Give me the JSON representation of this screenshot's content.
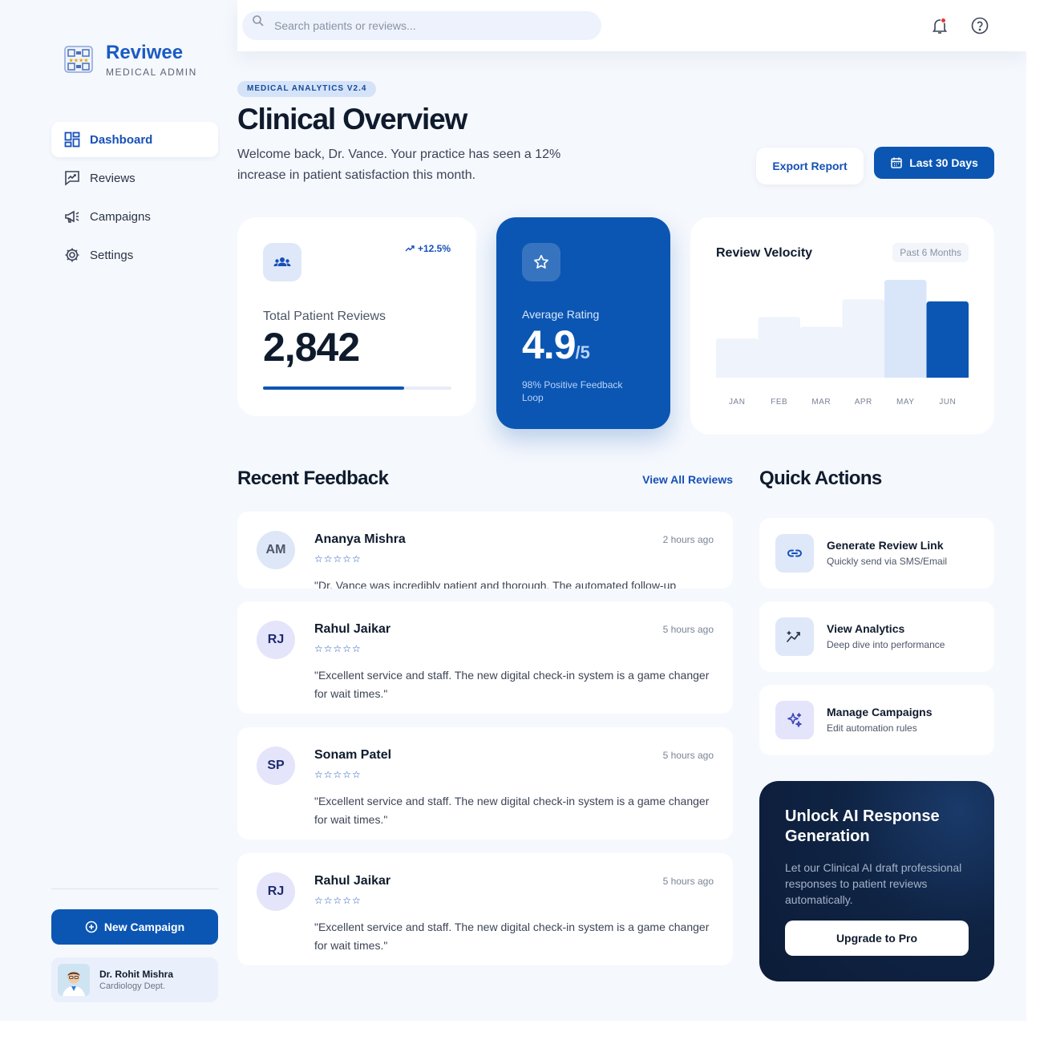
{
  "brand": {
    "name": "Reviwee",
    "subtitle": "MEDICAL ADMIN"
  },
  "nav": [
    {
      "label": "Dashboard",
      "icon": "dashboard-icon",
      "active": true
    },
    {
      "label": "Reviews",
      "icon": "reviews-icon",
      "active": false
    },
    {
      "label": "Campaigns",
      "icon": "megaphone-icon",
      "active": false
    },
    {
      "label": "Settings",
      "icon": "gear-icon",
      "active": false
    }
  ],
  "sidebar": {
    "new_campaign_label": "New Campaign"
  },
  "profile": {
    "name": "Dr. Rohit Mishra",
    "dept": "Cardiology Dept."
  },
  "search": {
    "placeholder": "Search patients or reviews..."
  },
  "header": {
    "badge": "MEDICAL ANALYTICS V2.4",
    "title": "Clinical Overview",
    "subtitle": "Welcome back, Dr. Vance. Your practice has seen a 12% increase in patient satisfaction this month.",
    "export_label": "Export Report",
    "range_label": "Last 30 Days"
  },
  "stats": {
    "total_reviews": {
      "label": "Total Patient Reviews",
      "value": "2,842",
      "trend": "+12.5%",
      "progress": 0.75
    },
    "rating": {
      "label": "Average Rating",
      "value": "4.9",
      "suffix": "/5",
      "footer": "98% Positive Feedback Loop"
    }
  },
  "velocity": {
    "title": "Review Velocity",
    "period": "Past 6 Months"
  },
  "chart_data": {
    "type": "bar",
    "title": "Review Velocity",
    "categories": [
      "JAN",
      "FEB",
      "MAR",
      "APR",
      "MAY",
      "JUN"
    ],
    "values": [
      40,
      62,
      52,
      80,
      100,
      78
    ],
    "ylim": [
      0,
      100
    ],
    "grid": false,
    "highlight": "JUN",
    "colors": {
      "base": "#eef3fc",
      "mid": "#d9e6fa",
      "highlight": "#0b56b3"
    }
  },
  "feedback": {
    "title": "Recent Feedback",
    "view_all": "View All Reviews",
    "items": [
      {
        "initials": "AM",
        "name": "Ananya Mishra",
        "time": "2 hours ago",
        "stars": "☆☆☆☆☆",
        "text": "\"Dr. Vance was incredibly patient and thorough. The automated follow-up reminders were a nice touch of professionalism for my procedure.\"",
        "avatar_bg": "#dde7f7",
        "avatar_fg": "#4d5668"
      },
      {
        "initials": "RJ",
        "name": "Rahul Jaikar",
        "time": "5 hours ago",
        "stars": "☆☆☆☆☆",
        "text": "\"Excellent service and staff. The new digital check-in system is a game changer for wait times.\"",
        "avatar_bg": "#e4e4fb",
        "avatar_fg": "#1d2a6e"
      },
      {
        "initials": "SP",
        "name": "Sonam Patel",
        "time": "5 hours ago",
        "stars": "☆☆☆☆☆",
        "text": "\"Excellent service and staff. The new digital check-in system is a game changer for wait times.\"",
        "avatar_bg": "#e4e4fb",
        "avatar_fg": "#1d2a6e"
      },
      {
        "initials": "RJ",
        "name": "Rahul Jaikar",
        "time": "5 hours ago",
        "stars": "☆☆☆☆☆",
        "text": "\"Excellent service and staff. The new digital check-in system is a game changer for wait times.\"",
        "avatar_bg": "#e4e4fb",
        "avatar_fg": "#1d2a6e"
      }
    ]
  },
  "quick_actions": {
    "title": "Quick Actions",
    "items": [
      {
        "title": "Generate Review Link",
        "subtitle": "Quickly send via SMS/Email",
        "icon": "link-icon"
      },
      {
        "title": "View Analytics",
        "subtitle": "Deep dive into performance",
        "icon": "analytics-icon"
      },
      {
        "title": "Manage Campaigns",
        "subtitle": "Edit automation rules",
        "icon": "sparkle-icon"
      }
    ]
  },
  "promo": {
    "title": "Unlock AI Response Generation",
    "text": "Let our Clinical AI draft professional responses to patient reviews automatically.",
    "button": "Upgrade to Pro"
  }
}
